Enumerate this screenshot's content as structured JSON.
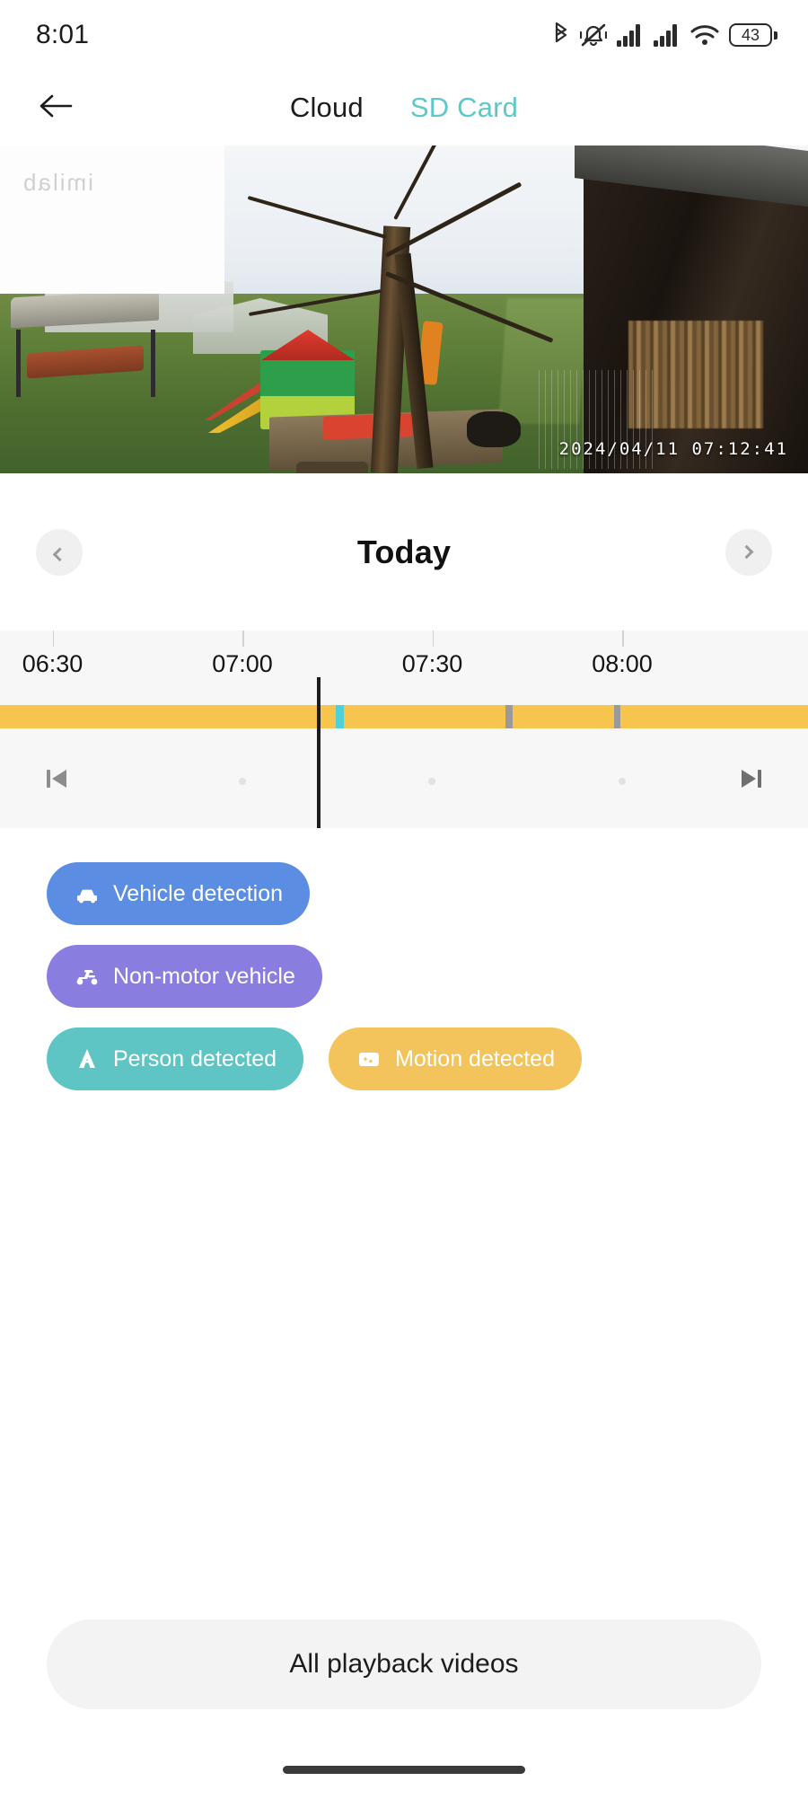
{
  "status_bar": {
    "time": "8:01",
    "icons": [
      "bluetooth-icon",
      "mute-vibrate-icon",
      "signal-bars-icon",
      "signal-bars-2-icon",
      "wifi-icon"
    ],
    "battery_level": "43"
  },
  "header": {
    "back_icon": "back-arrow-icon",
    "tabs": [
      {
        "label": "Cloud",
        "active": false
      },
      {
        "label": "SD Card",
        "active": true
      }
    ],
    "active_tab_color": "#5ec8c8"
  },
  "video": {
    "watermark": "imilab",
    "timestamp": "2024/04/11 07:12:41"
  },
  "day_nav": {
    "prev_icon": "chevron-left-icon",
    "title": "Today",
    "next_icon": "chevron-right-icon"
  },
  "timeline": {
    "labels": [
      "06:30",
      "07:00",
      "07:30",
      "08:00"
    ],
    "label_positions_pct": [
      6.5,
      30,
      53.5,
      77
    ],
    "tick_positions_pct": [
      6.5,
      30,
      53.5,
      77,
      100
    ],
    "track_color": "#f7c44e",
    "playhead_position_pct": 39.2,
    "segments": [
      {
        "start_pct": 41.5,
        "width_pct": 1.0,
        "color": "#4fd1d9",
        "name": "person-event"
      },
      {
        "start_pct": 62.5,
        "width_pct": 0.9,
        "color": "#9a9a9a",
        "name": "gap-marker"
      },
      {
        "start_pct": 76.0,
        "width_pct": 0.8,
        "color": "#9a9a9a",
        "name": "gap-marker-2"
      }
    ],
    "controls": {
      "prev_icon": "skip-previous-icon",
      "next_icon": "skip-next-icon"
    },
    "dot_positions_pct": [
      29.5,
      53,
      76.5
    ]
  },
  "filters": [
    {
      "label": "Vehicle detection",
      "icon": "car-icon",
      "color": "#5b8ee3"
    },
    {
      "label": "Non-motor vehicle",
      "icon": "scooter-icon",
      "color": "#8a7de0"
    },
    {
      "label": "Person detected",
      "icon": "person-icon",
      "color": "#5ec4c4"
    },
    {
      "label": "Motion detected",
      "icon": "motion-icon",
      "color": "#f3c35c"
    }
  ],
  "footer": {
    "all_videos_label": "All playback videos",
    "home_indicator": "home-indicator"
  }
}
